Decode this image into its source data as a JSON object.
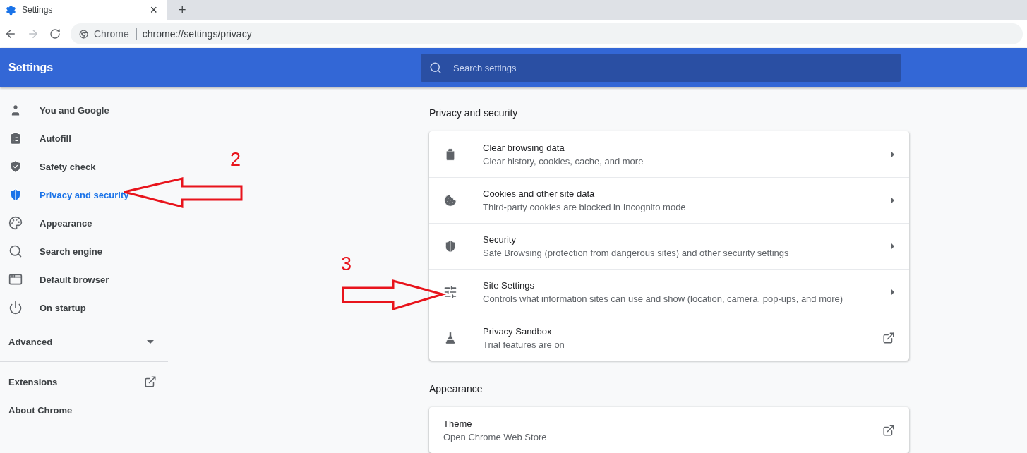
{
  "tab": {
    "title": "Settings",
    "close": "×",
    "new_tab": "+"
  },
  "address_bar": {
    "site_label": "Chrome",
    "url": "chrome://settings/privacy"
  },
  "header": {
    "title": "Settings",
    "search": {
      "placeholder": "Search settings"
    }
  },
  "sidebar": {
    "items": [
      {
        "label": "You and Google",
        "selected": false
      },
      {
        "label": "Autofill",
        "selected": false
      },
      {
        "label": "Safety check",
        "selected": false
      },
      {
        "label": "Privacy and security",
        "selected": true
      },
      {
        "label": "Appearance",
        "selected": false
      },
      {
        "label": "Search engine",
        "selected": false
      },
      {
        "label": "Default browser",
        "selected": false
      },
      {
        "label": "On startup",
        "selected": false
      }
    ],
    "advanced": {
      "label": "Advanced",
      "expanded": false
    },
    "links": [
      {
        "label": "Extensions",
        "kind": "external"
      },
      {
        "label": "About Chrome",
        "kind": "plain"
      }
    ]
  },
  "sections": [
    {
      "title": "Privacy and security",
      "rows": [
        {
          "title": "Clear browsing data",
          "subtitle": "Clear history, cookies, cache, and more",
          "kind": "chevron"
        },
        {
          "title": "Cookies and other site data",
          "subtitle": "Third-party cookies are blocked in Incognito mode",
          "kind": "chevron"
        },
        {
          "title": "Security",
          "subtitle": "Safe Browsing (protection from dangerous sites) and other security settings",
          "kind": "chevron"
        },
        {
          "title": "Site Settings",
          "subtitle": "Controls what information sites can use and show (location, camera, pop-ups, and more)",
          "kind": "chevron"
        },
        {
          "title": "Privacy Sandbox",
          "subtitle": "Trial features are on",
          "kind": "external"
        }
      ]
    },
    {
      "title": "Appearance",
      "rows": [
        {
          "title": "Theme",
          "subtitle": "Open Chrome Web Store",
          "kind": "external"
        }
      ]
    }
  ],
  "annotations": [
    {
      "number": "2"
    },
    {
      "number": "3"
    }
  ]
}
